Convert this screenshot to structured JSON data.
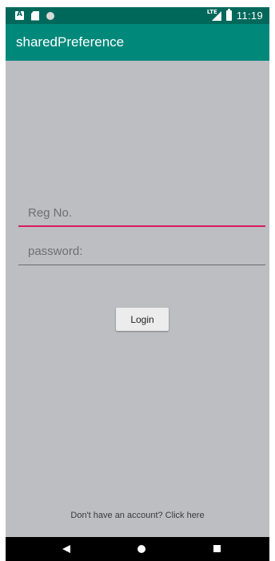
{
  "status_bar": {
    "time": "11:19",
    "network_label": "LTE",
    "icons": [
      "notification-a-icon",
      "sd-card-icon",
      "circle-notification-icon",
      "signal-icon",
      "battery-icon"
    ]
  },
  "app_bar": {
    "title": "sharedPreference",
    "color": "#00887a",
    "status_color": "#00685b"
  },
  "form": {
    "reg_no_placeholder": "Reg No.",
    "reg_no_value": "",
    "password_placeholder": "password:",
    "password_value": "",
    "focused_underline_color": "#d81b60",
    "login_label": "Login"
  },
  "footer": {
    "signup_link": "Don't have an account? Click here"
  },
  "nav_bar": {
    "icons": [
      "back-icon",
      "home-icon",
      "recents-icon"
    ]
  }
}
